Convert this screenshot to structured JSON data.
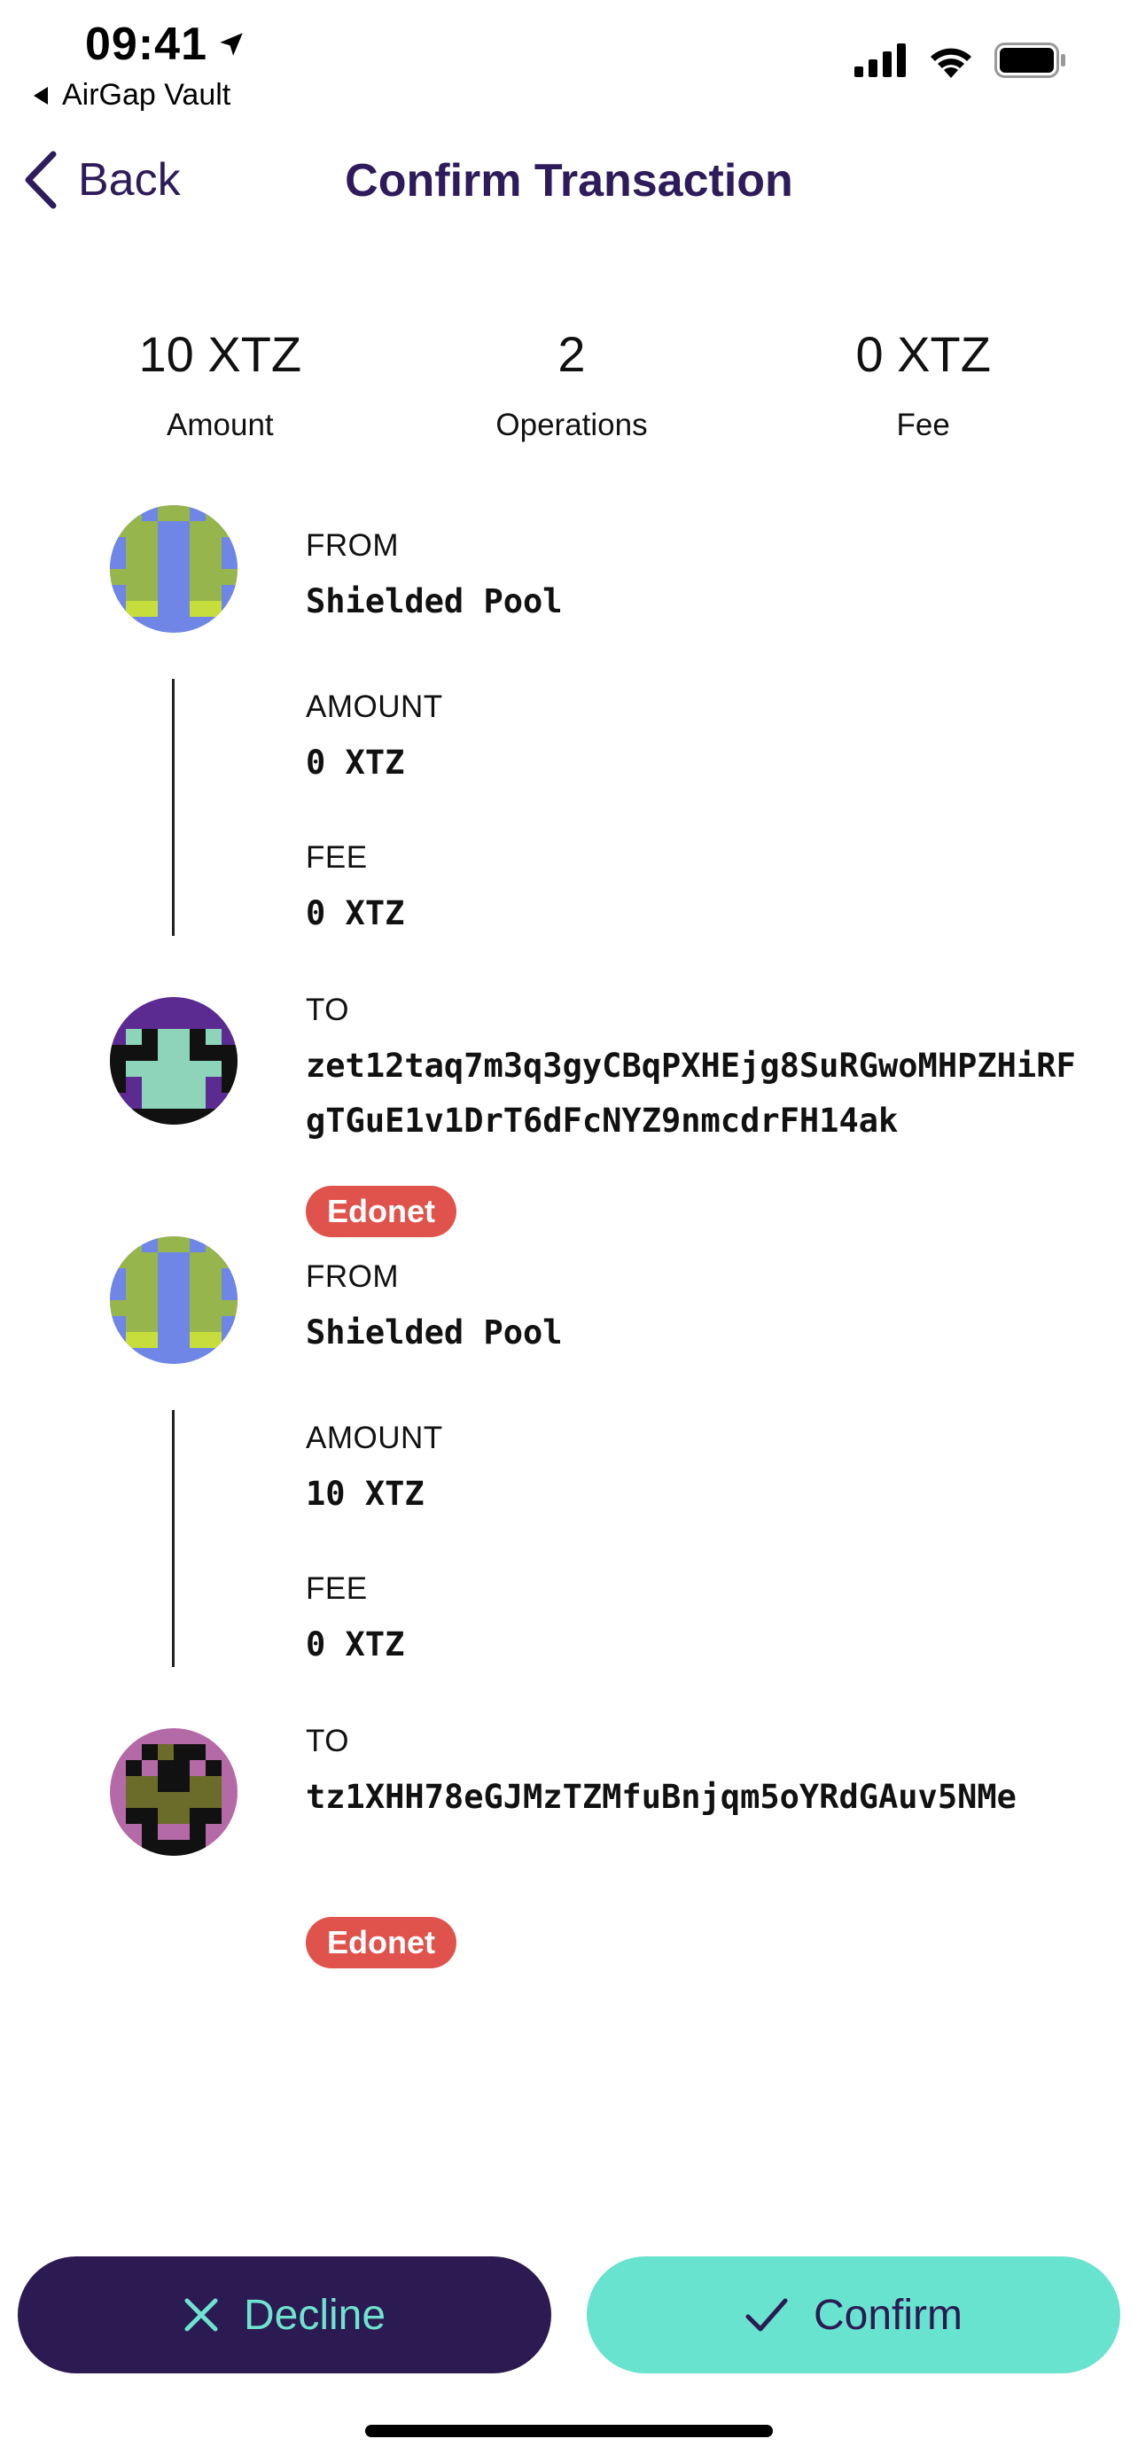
{
  "status_bar": {
    "time": "09:41",
    "back_app": "AirGap Vault"
  },
  "nav": {
    "back_label": "Back",
    "title": "Confirm Transaction"
  },
  "summary": {
    "amount_value": "10 XTZ",
    "amount_label": "Amount",
    "operations_value": "2",
    "operations_label": "Operations",
    "fee_value": "0 XTZ",
    "fee_label": "Fee"
  },
  "operations": [
    {
      "from_label": "FROM",
      "from_value": "Shielded Pool",
      "amount_label": "AMOUNT",
      "amount_value": "0 XTZ",
      "fee_label": "FEE",
      "fee_value": "0 XTZ",
      "to_label": "TO",
      "to_value": "zet12taq7m3q3gyCBqPXHEjg8SuRGwoMHPZHiRFgTGuE1v1DrT6dFcNYZ9nmcdrFH14ak",
      "network": "Edonet"
    },
    {
      "from_label": "FROM",
      "from_value": "Shielded Pool",
      "amount_label": "AMOUNT",
      "amount_value": "10 XTZ",
      "fee_label": "FEE",
      "fee_value": "0 XTZ",
      "to_label": "TO",
      "to_value": "tz1XHH78eGJMzTZMfuBnjqm5oYRdGAuv5NMe",
      "network": "Edonet"
    }
  ],
  "buttons": {
    "decline": "Decline",
    "confirm": "Confirm"
  },
  "colors": {
    "primary": "#2c1a52",
    "accent": "#67e3cf",
    "network_badge": "#e0534c"
  }
}
